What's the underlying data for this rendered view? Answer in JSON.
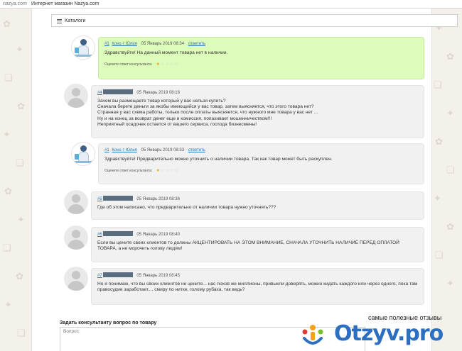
{
  "browser": {
    "url": "nazya.com",
    "title": "Интернет магазин Nazya.com"
  },
  "catalog": {
    "label": "Каталоги"
  },
  "reviews": [
    {
      "type": "consultant",
      "num": "#1",
      "name": "Конс-т Юлия",
      "date": "05 Январь 2019 08:34",
      "reply": "ответить",
      "text": "Здравствуйте! На данный момент товара нет в наличии.",
      "rating_label": "Оцените ответ консультанта:",
      "stars_on": 1
    },
    {
      "type": "user",
      "num": "#4",
      "date": "05 Январь 2019 08:16",
      "text": "Зачем вы размещаете товар который у вас нельзя купить?\nСначала берете деньги за якобы имеющийся у вас товар, затем выясняется, что этого товара нет?\nСтранная у вас схема работы, только после оплаты выясняется, что нужного мне товара у вас нет ...\nНу и на конец за возврат денег еще и комиссия, попахивает мошенничеством!!!\nНеприятный осадочек остается от вашего сервиса, господа бизнесмены!"
    },
    {
      "type": "consultant",
      "num": "#1",
      "name": "Конс-т Юлия",
      "date": "05 Январь 2019 08:33",
      "reply": "ответить",
      "text": "Здравствуйте! Предварительно можно уточнить о наличии товара. Так как товар может быть раскуплен.",
      "rating_label": "Оцените ответ консультанта:",
      "stars_on": 1
    },
    {
      "type": "user",
      "num": "#5",
      "date": "05 Январь 2019 08:36",
      "text": "Где об этом написано, что предварительно от наличии товара нужно уточнять???"
    },
    {
      "type": "user",
      "num": "#6",
      "date": "05 Январь 2019 08:40",
      "text": "Если вы цените своих клиентов то должны АКЦЕНТИРОВАТЬ НА ЭТОМ ВНИМАНИЕ, СНАЧАЛА УТОЧНИТЬ НАЛИЧИЕ ПЕРЕД ОПЛАТОЙ ТОВАРА, а не морочить голову людям!"
    },
    {
      "type": "user",
      "num": "#7",
      "date": "05 Январь 2019 08:45",
      "text": "Но я понимаю, что вы своих клиентов не цените... нас лохов же миллионы, привыкли доверять, можно кидать каждого или через одного, пока там правосудие заработает.... смиру по нитке, голому рубаха, так ведь?"
    }
  ],
  "ask": {
    "title": "Задать консультанту вопрос по товару",
    "placeholder": "Вопрос:"
  },
  "watermark": {
    "tagline": "самые полезные отзывы",
    "logo": "Otzyv.pro"
  },
  "colors": {
    "consultant_bubble": "#ddfbba",
    "user_bubble": "#f1f1f1",
    "link": "#2f79b6",
    "logo": "#2c6fc0"
  }
}
